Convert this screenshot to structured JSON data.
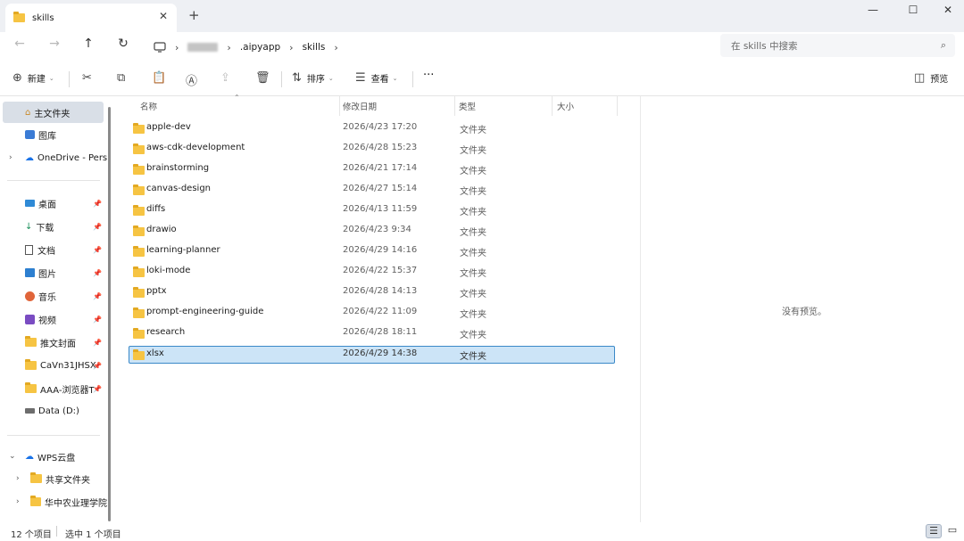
{
  "window": {
    "tab_title": "skills",
    "close_tab": "✕",
    "new_tab": "+",
    "minimize": "—",
    "maximize": "☐",
    "close": "✕"
  },
  "address": {
    "breadcrumb": [
      ".aipyapp",
      "skills"
    ],
    "search_placeholder": "在 skills 中搜索"
  },
  "toolbar": {
    "new_label": "新建",
    "sort_label": "排序",
    "view_label": "查看",
    "more": "···",
    "preview_label": "预览"
  },
  "sidebar": {
    "home": "主文件夹",
    "gallery": "图库",
    "onedrive": "OneDrive - Pers",
    "quick_access": [
      {
        "label": "桌面"
      },
      {
        "label": "下载"
      },
      {
        "label": "文档"
      },
      {
        "label": "图片"
      },
      {
        "label": "音乐"
      },
      {
        "label": "视频"
      },
      {
        "label": "推文封面"
      },
      {
        "label": "CaVn31JHSX"
      },
      {
        "label": "AAA-浏览器T"
      }
    ],
    "drive": "Data (D:)",
    "wps": "WPS云盘",
    "wps_items": [
      {
        "label": "共享文件夹"
      },
      {
        "label": "华中农业理学院"
      }
    ]
  },
  "columns": {
    "name": "名称",
    "modified": "修改日期",
    "type": "类型",
    "size": "大小"
  },
  "files": [
    {
      "name": "apple-dev",
      "modified": "2026/4/23 17:20",
      "type": "文件夹"
    },
    {
      "name": "aws-cdk-development",
      "modified": "2026/4/28 15:23",
      "type": "文件夹"
    },
    {
      "name": "brainstorming",
      "modified": "2026/4/21 17:14",
      "type": "文件夹"
    },
    {
      "name": "canvas-design",
      "modified": "2026/4/27 15:14",
      "type": "文件夹"
    },
    {
      "name": "diffs",
      "modified": "2026/4/13 11:59",
      "type": "文件夹"
    },
    {
      "name": "drawio",
      "modified": "2026/4/23 9:34",
      "type": "文件夹"
    },
    {
      "name": "learning-planner",
      "modified": "2026/4/29 14:16",
      "type": "文件夹"
    },
    {
      "name": "loki-mode",
      "modified": "2026/4/22 15:37",
      "type": "文件夹"
    },
    {
      "name": "pptx",
      "modified": "2026/4/28 14:13",
      "type": "文件夹"
    },
    {
      "name": "prompt-engineering-guide",
      "modified": "2026/4/22 11:09",
      "type": "文件夹"
    },
    {
      "name": "research",
      "modified": "2026/4/28 18:11",
      "type": "文件夹"
    },
    {
      "name": "xlsx",
      "modified": "2026/4/29 14:38",
      "type": "文件夹"
    }
  ],
  "preview": {
    "empty_text": "没有预览。"
  },
  "status": {
    "count": "12 个项目",
    "selection": "选中 1 个项目"
  },
  "colors": {
    "selection_fill": "#cce4f7",
    "selection_border": "#3b89c8",
    "folder": "#f6c443"
  }
}
